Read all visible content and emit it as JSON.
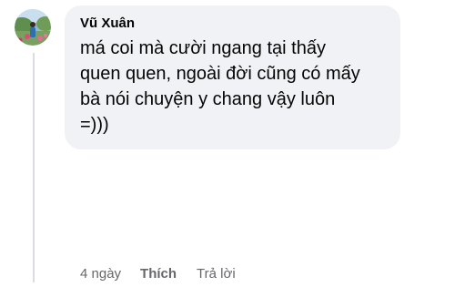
{
  "comment": {
    "author": "Vũ Xuân",
    "text": "má coi mà cười ngang tại thấy\nquen quen, ngoài đời cũng có mấy\nbà nói chuyện y chang vậy luôn\n=)))",
    "avatar_icon": "profile-photo-avatar"
  },
  "actions": {
    "timestamp": "4 ngày",
    "like_label": "Thích",
    "reply_label": "Trả lời"
  },
  "colors": {
    "bubble_bg": "#f0f2f5",
    "text_primary": "#050505",
    "text_secondary": "#65676b",
    "thread_line": "#d9dce0"
  }
}
